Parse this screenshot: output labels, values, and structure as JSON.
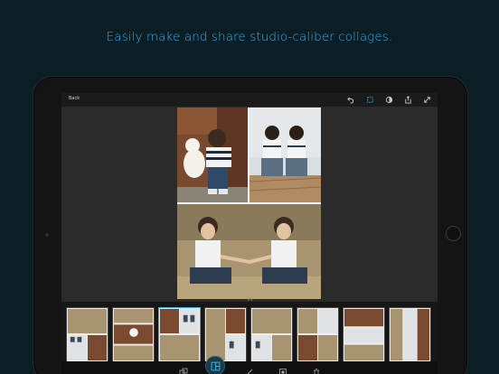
{
  "headline": "Easily make and share studio-caliber collages.",
  "topbar": {
    "back_label": "Back",
    "icons": [
      "undo-icon",
      "crop-icon",
      "adjust-icon",
      "share-icon",
      "expand-icon"
    ]
  },
  "collage": {
    "layout": "two-top-one-bottom",
    "photos": [
      "boy-hugging-white-dog",
      "two-boys-sitting-back-view",
      "two-boys-holding-hands-in-field"
    ]
  },
  "layout_strip": {
    "count": 9,
    "selected_index": 2
  },
  "bottombar": {
    "icons": [
      "layers-icon",
      "layout-icon",
      "brush-icon",
      "border-icon",
      "delete-icon"
    ],
    "active": "layout-icon"
  },
  "colors": {
    "background": "#0b1d25",
    "accent": "#3aaee8",
    "screen": "#2b2b2b"
  }
}
